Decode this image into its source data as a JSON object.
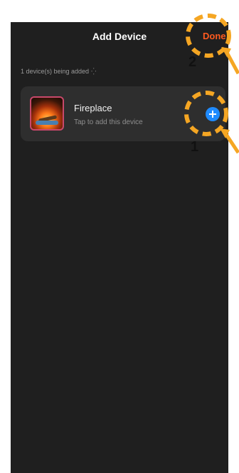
{
  "header": {
    "title": "Add Device",
    "done_label": "Done"
  },
  "status": {
    "text": "1 device(s) being added",
    "spinner": "⁛"
  },
  "device": {
    "name": "Fireplace",
    "subtitle": "Tap to add this device",
    "add_icon": "plus-circle-icon"
  },
  "annotations": {
    "step1": "1",
    "step2": "2"
  },
  "colors": {
    "background": "#1f1f1f",
    "card": "#2e2e2e",
    "accent_done": "#ff5a1f",
    "add_button": "#1f8bff",
    "callout": "#f5a623"
  }
}
